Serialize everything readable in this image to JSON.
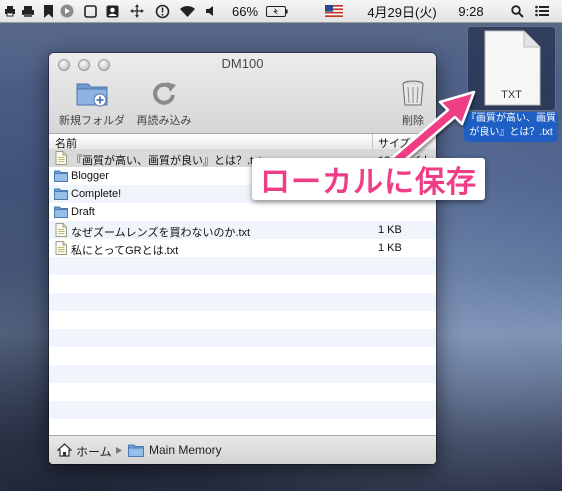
{
  "menubar": {
    "battery_percent": "66%",
    "date": "4月29日(火)",
    "time": "9:28",
    "flag_icon": "us-flag-icon"
  },
  "window": {
    "title": "DM100",
    "toolbar": {
      "new_folder_label": "新規フォルダ",
      "reload_label": "再読み込み",
      "delete_label": "削除"
    },
    "columns": {
      "name": "名前",
      "size": "サイズ"
    },
    "files": [
      {
        "name": "『画質が高い、画質が良い』とは？.txt",
        "size": "186 バイト",
        "type": "text",
        "selected": true
      },
      {
        "name": "Blogger",
        "size": "",
        "type": "folder"
      },
      {
        "name": "Complete!",
        "size": "",
        "type": "folder"
      },
      {
        "name": "Draft",
        "size": "",
        "type": "folder"
      },
      {
        "name": "なぜズームレンズを買わないのか.txt",
        "size": "1 KB",
        "type": "text"
      },
      {
        "name": "私にとってGRとは.txt",
        "size": "1 KB",
        "type": "text"
      }
    ],
    "path": {
      "home": "ホーム",
      "current": "Main Memory"
    }
  },
  "desktop_file": {
    "badge": "TXT",
    "caption_line1": "『画質が高い、画質",
    "caption_line2": "が良い』とは？.txt"
  },
  "annotation": {
    "text": "ローカルに保存",
    "color": "#ef3d86"
  }
}
